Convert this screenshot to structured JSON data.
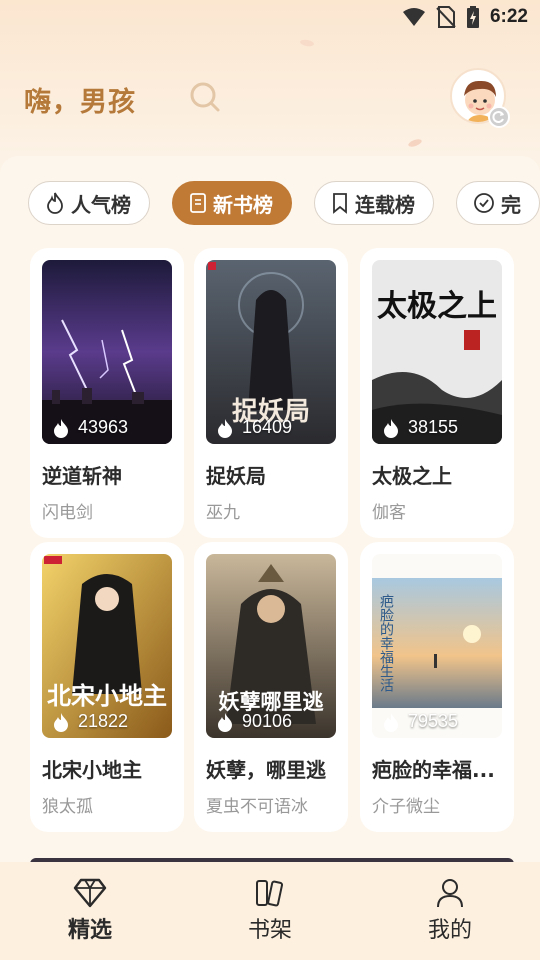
{
  "status_bar": {
    "time": "6:22"
  },
  "header": {
    "greeting": "嗨，男孩"
  },
  "tabs": [
    {
      "label": "人气榜",
      "icon": "flame-icon",
      "active": false
    },
    {
      "label": "新书榜",
      "icon": "book-icon",
      "active": true
    },
    {
      "label": "连载榜",
      "icon": "bookmark-icon",
      "active": false
    },
    {
      "label": "完",
      "icon": "check-circle-icon",
      "active": false
    }
  ],
  "books": [
    {
      "title": "逆道斩神",
      "author": "闪电剑",
      "heat": "43963"
    },
    {
      "title": "捉妖局",
      "author": "巫九",
      "heat": "16409",
      "cover_text": "捉妖局"
    },
    {
      "title": "太极之上",
      "author": "伽客",
      "heat": "38155",
      "cover_text": "太极之上"
    },
    {
      "title": "北宋小地主",
      "author": "狼太孤",
      "heat": "21822",
      "cover_text": "北宋小地主"
    },
    {
      "title": "妖孽，哪里逃",
      "author": "夏虫不可语冰",
      "heat": "90106",
      "cover_text": "妖孽哪里逃"
    },
    {
      "title": "疤脸的幸福...",
      "author": "介子微尘",
      "heat": "79535",
      "cover_text": "疤脸的幸福生活"
    }
  ],
  "bottom_nav": [
    {
      "label": "精选",
      "icon": "diamond-icon",
      "active": true
    },
    {
      "label": "书架",
      "icon": "bookshelf-icon",
      "active": false
    },
    {
      "label": "我的",
      "icon": "person-icon",
      "active": false
    }
  ],
  "colors": {
    "accent": "#c07a36",
    "greeting": "#b57a3a",
    "background": "#fdf6ec"
  }
}
